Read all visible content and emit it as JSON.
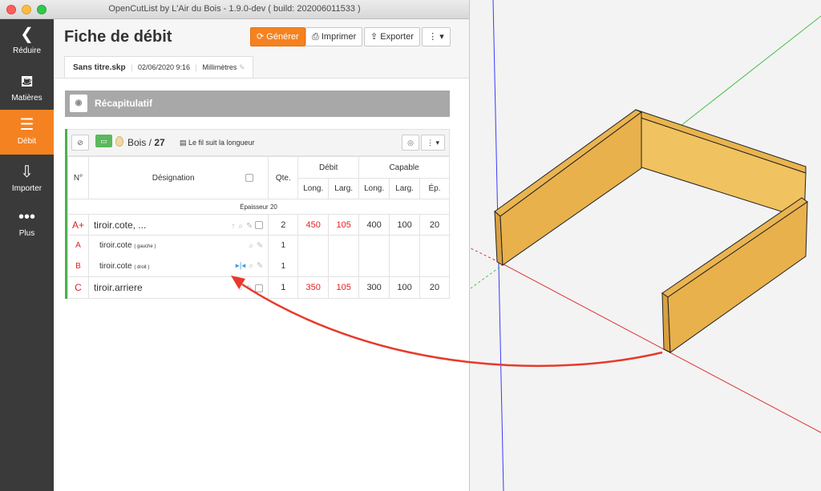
{
  "window": {
    "title": "OpenCutList by L'Air du Bois - 1.9.0-dev ( build: 202006011533 )"
  },
  "sidebar": {
    "items": [
      {
        "label": "Réduire",
        "icon": "chevron-left-icon"
      },
      {
        "label": "Matières",
        "icon": "paint-bucket-icon"
      },
      {
        "label": "Débit",
        "icon": "list-icon",
        "active": true
      },
      {
        "label": "Importer",
        "icon": "import-icon"
      },
      {
        "label": "Plus",
        "icon": "more-dots-icon"
      }
    ]
  },
  "header": {
    "title": "Fiche de débit",
    "generate_label": "Générer",
    "print_label": "Imprimer",
    "export_label": "Exporter",
    "more_label": "⋮ ▾"
  },
  "tab": {
    "filename": "Sans titre.skp",
    "date": "02/06/2020 9:16",
    "unit": "Millimètres"
  },
  "summary": {
    "label": "Récapitulatif"
  },
  "group": {
    "material": "Bois",
    "thickness": "27",
    "grain_label": "Le fil suit la longueur",
    "columns": {
      "number": "N°",
      "designation": "Désignation",
      "qty": "Qte.",
      "cutting": "Débit",
      "finished": "Capable",
      "length": "Long.",
      "width": "Larg.",
      "length2": "Long.",
      "width2": "Larg.",
      "thickness": "Ép."
    },
    "thickness_label": "Épaisseur 20",
    "rows": [
      {
        "num": "A+",
        "name": "tiroir.cote, ...",
        "qty": "2",
        "cut_len": "450",
        "cut_wid": "105",
        "len": "400",
        "wid": "100",
        "ep": "20"
      },
      {
        "num": "A",
        "name": "tiroir.cote",
        "tag": "( gauche )",
        "qty": "1"
      },
      {
        "num": "B",
        "name": "tiroir.cote",
        "tag": "( droit )",
        "qty": "1"
      },
      {
        "num": "C",
        "name": "tiroir.arriere",
        "qty": "1",
        "cut_len": "350",
        "cut_wid": "105",
        "len": "300",
        "wid": "100",
        "ep": "20"
      }
    ]
  },
  "colors": {
    "accent": "#f58220",
    "sidebar": "#3a3a3a",
    "group_border": "#4caf50",
    "red_value": "#e41e1e",
    "wood": "#e8b14c"
  }
}
